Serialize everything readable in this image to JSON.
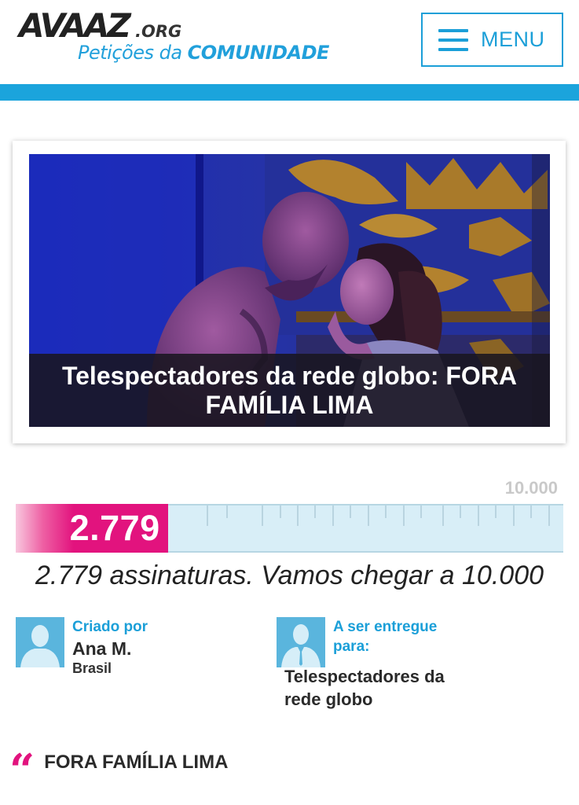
{
  "header": {
    "logo_brand": "AVAAZ",
    "logo_domain": ".ORG",
    "logo_tagline_part1": "Petições da ",
    "logo_tagline_part2": "COMUNIDADE",
    "menu_label": "MENU",
    "accent_color": "#1ba4dc"
  },
  "petition": {
    "title": "Telespectadores da rede globo: FORA FAMÍLIA LIMA",
    "image_description_icon": "photo"
  },
  "progress": {
    "goal": "10.000",
    "current": "2.779",
    "fraction": 0.2779,
    "summary": "2.779 assinaturas. Vamos chegar a 10.000",
    "fill_color": "#e2137e"
  },
  "creator": {
    "label": "Criado por",
    "name": "Ana M.",
    "country": "Brasil"
  },
  "recipient": {
    "label": "A ser entregue para:",
    "target": "Telespectadores da rede globo"
  },
  "quote": {
    "mark": "“",
    "text": "FORA FAMÍLIA LIMA"
  }
}
